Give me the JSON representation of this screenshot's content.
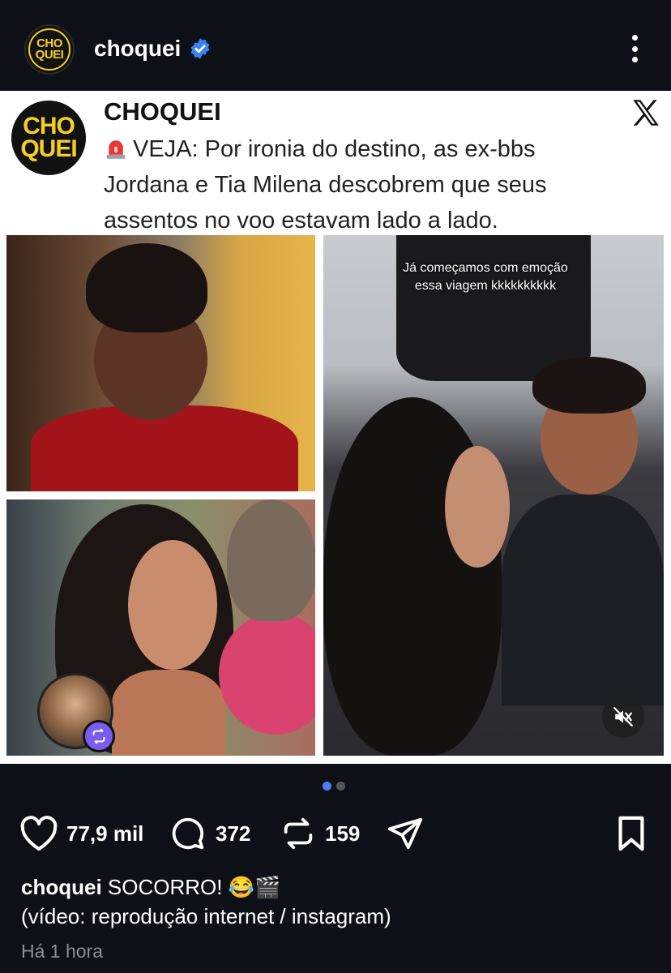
{
  "header": {
    "avatar_text_1": "CHO",
    "avatar_text_2": "QUEI",
    "username": "choquei",
    "verified_icon": "verified-badge-icon",
    "more_icon": "more-vertical-icon"
  },
  "post": {
    "logo_line_1": "CHO",
    "logo_line_2": "QUEI",
    "title": "CHOQUEI",
    "source_icon": "x-logo-icon",
    "siren_icon": "siren-icon",
    "text": "VEJA: Por ironia do destino, as ex-bbs Jordana e Tia Milena descobrem que seus assentos no voo estavam lado a lado.",
    "video_overlay_text": "Já começamos com emoção essa viagem kkkkkkkkkk",
    "mute_icon": "muted-speaker-icon",
    "repost_badge_icon": "repost-icon"
  },
  "carousel": {
    "total": 2,
    "active_index": 0
  },
  "actions": {
    "likes": "77,9 mil",
    "comments": "372",
    "reposts": "159",
    "like_icon": "heart-icon",
    "comment_icon": "comment-icon",
    "repost_icon": "repost-icon",
    "share_icon": "send-icon",
    "bookmark_icon": "bookmark-icon"
  },
  "caption": {
    "username": "choquei",
    "text": "SOCORRO! 😂🎬",
    "line2": "(vídeo: reprodução internet / instagram)",
    "time": "Há 1 hora"
  },
  "colors": {
    "background": "#0d1117",
    "accent_yellow": "#f5d020",
    "verified_blue": "#3b82f6",
    "dot_active": "#4d7cf6",
    "repost_purple": "#7b5cf0"
  }
}
